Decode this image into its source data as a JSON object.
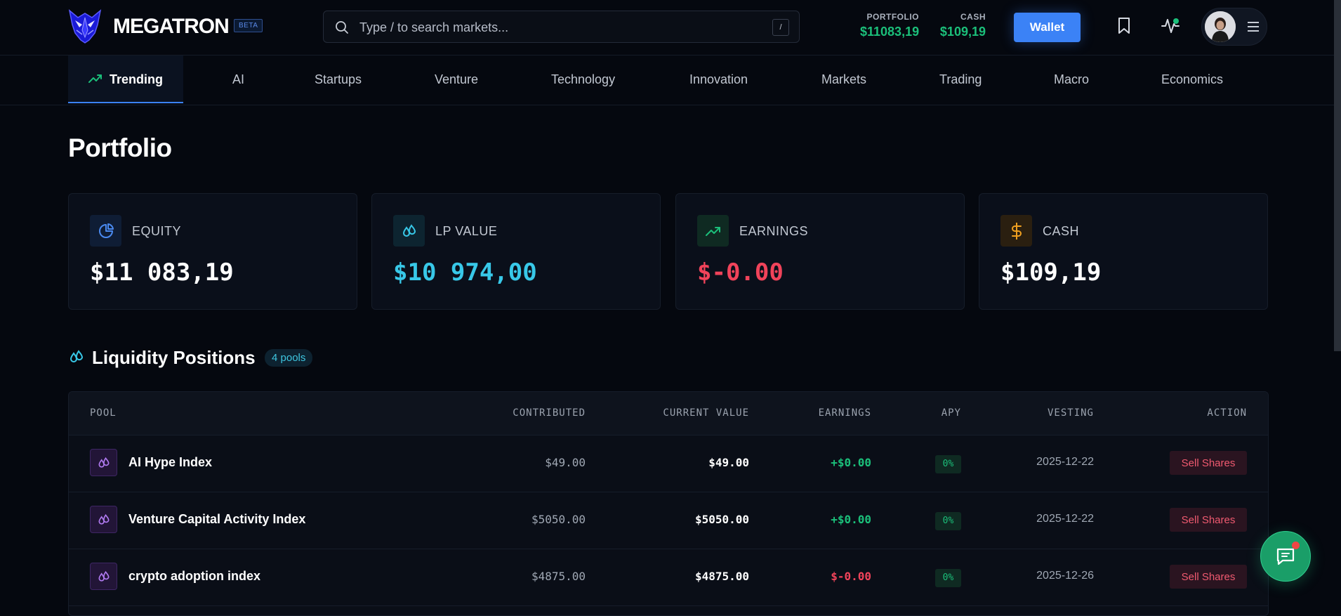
{
  "header": {
    "brand": "MEGATRON",
    "beta": "BETA",
    "search_placeholder": "Type / to search markets...",
    "search_shortcut": "/",
    "portfolio_label": "PORTFOLIO",
    "portfolio_value": "$11083,19",
    "cash_label": "CASH",
    "cash_value": "$109,19",
    "wallet_label": "Wallet"
  },
  "nav": {
    "tabs": [
      {
        "label": "Trending",
        "active": true
      },
      {
        "label": "AI"
      },
      {
        "label": "Startups"
      },
      {
        "label": "Venture"
      },
      {
        "label": "Technology"
      },
      {
        "label": "Innovation"
      },
      {
        "label": "Markets"
      },
      {
        "label": "Trading"
      },
      {
        "label": "Macro"
      },
      {
        "label": "Economics"
      }
    ]
  },
  "portfolio": {
    "title": "Portfolio",
    "cards": [
      {
        "label": "EQUITY",
        "value": "$11 083,19",
        "color": "#ffffff",
        "icon": "pie-chart-icon"
      },
      {
        "label": "LP VALUE",
        "value": "$10 974,00",
        "color": "#38c8e8",
        "icon": "droplets-icon"
      },
      {
        "label": "EARNINGS",
        "value": "$-0.00",
        "color": "#f0435a",
        "icon": "trending-up-icon"
      },
      {
        "label": "CASH",
        "value": "$109,19",
        "color": "#ffffff",
        "icon": "dollar-icon"
      }
    ]
  },
  "liquidity": {
    "title": "Liquidity Positions",
    "count_badge": "4 pools",
    "columns": [
      "POOL",
      "CONTRIBUTED",
      "CURRENT VALUE",
      "EARNINGS",
      "APY",
      "VESTING",
      "ACTION"
    ],
    "rows": [
      {
        "pool": "AI Hype Index",
        "contributed": "$49.00",
        "current": "$49.00",
        "earnings": "+$0.00",
        "earnings_color": "#1bbf7a",
        "apy": "0%",
        "vesting": "2025-12-22",
        "action": "Sell Shares"
      },
      {
        "pool": "Venture Capital Activity Index",
        "contributed": "$5050.00",
        "current": "$5050.00",
        "earnings": "+$0.00",
        "earnings_color": "#1bbf7a",
        "apy": "0%",
        "vesting": "2025-12-22",
        "action": "Sell Shares"
      },
      {
        "pool": "crypto adoption index",
        "contributed": "$4875.00",
        "current": "$4875.00",
        "earnings": "$-0.00",
        "earnings_color": "#f0435a",
        "apy": "0%",
        "vesting": "2025-12-26",
        "action": "Sell Shares"
      }
    ]
  }
}
